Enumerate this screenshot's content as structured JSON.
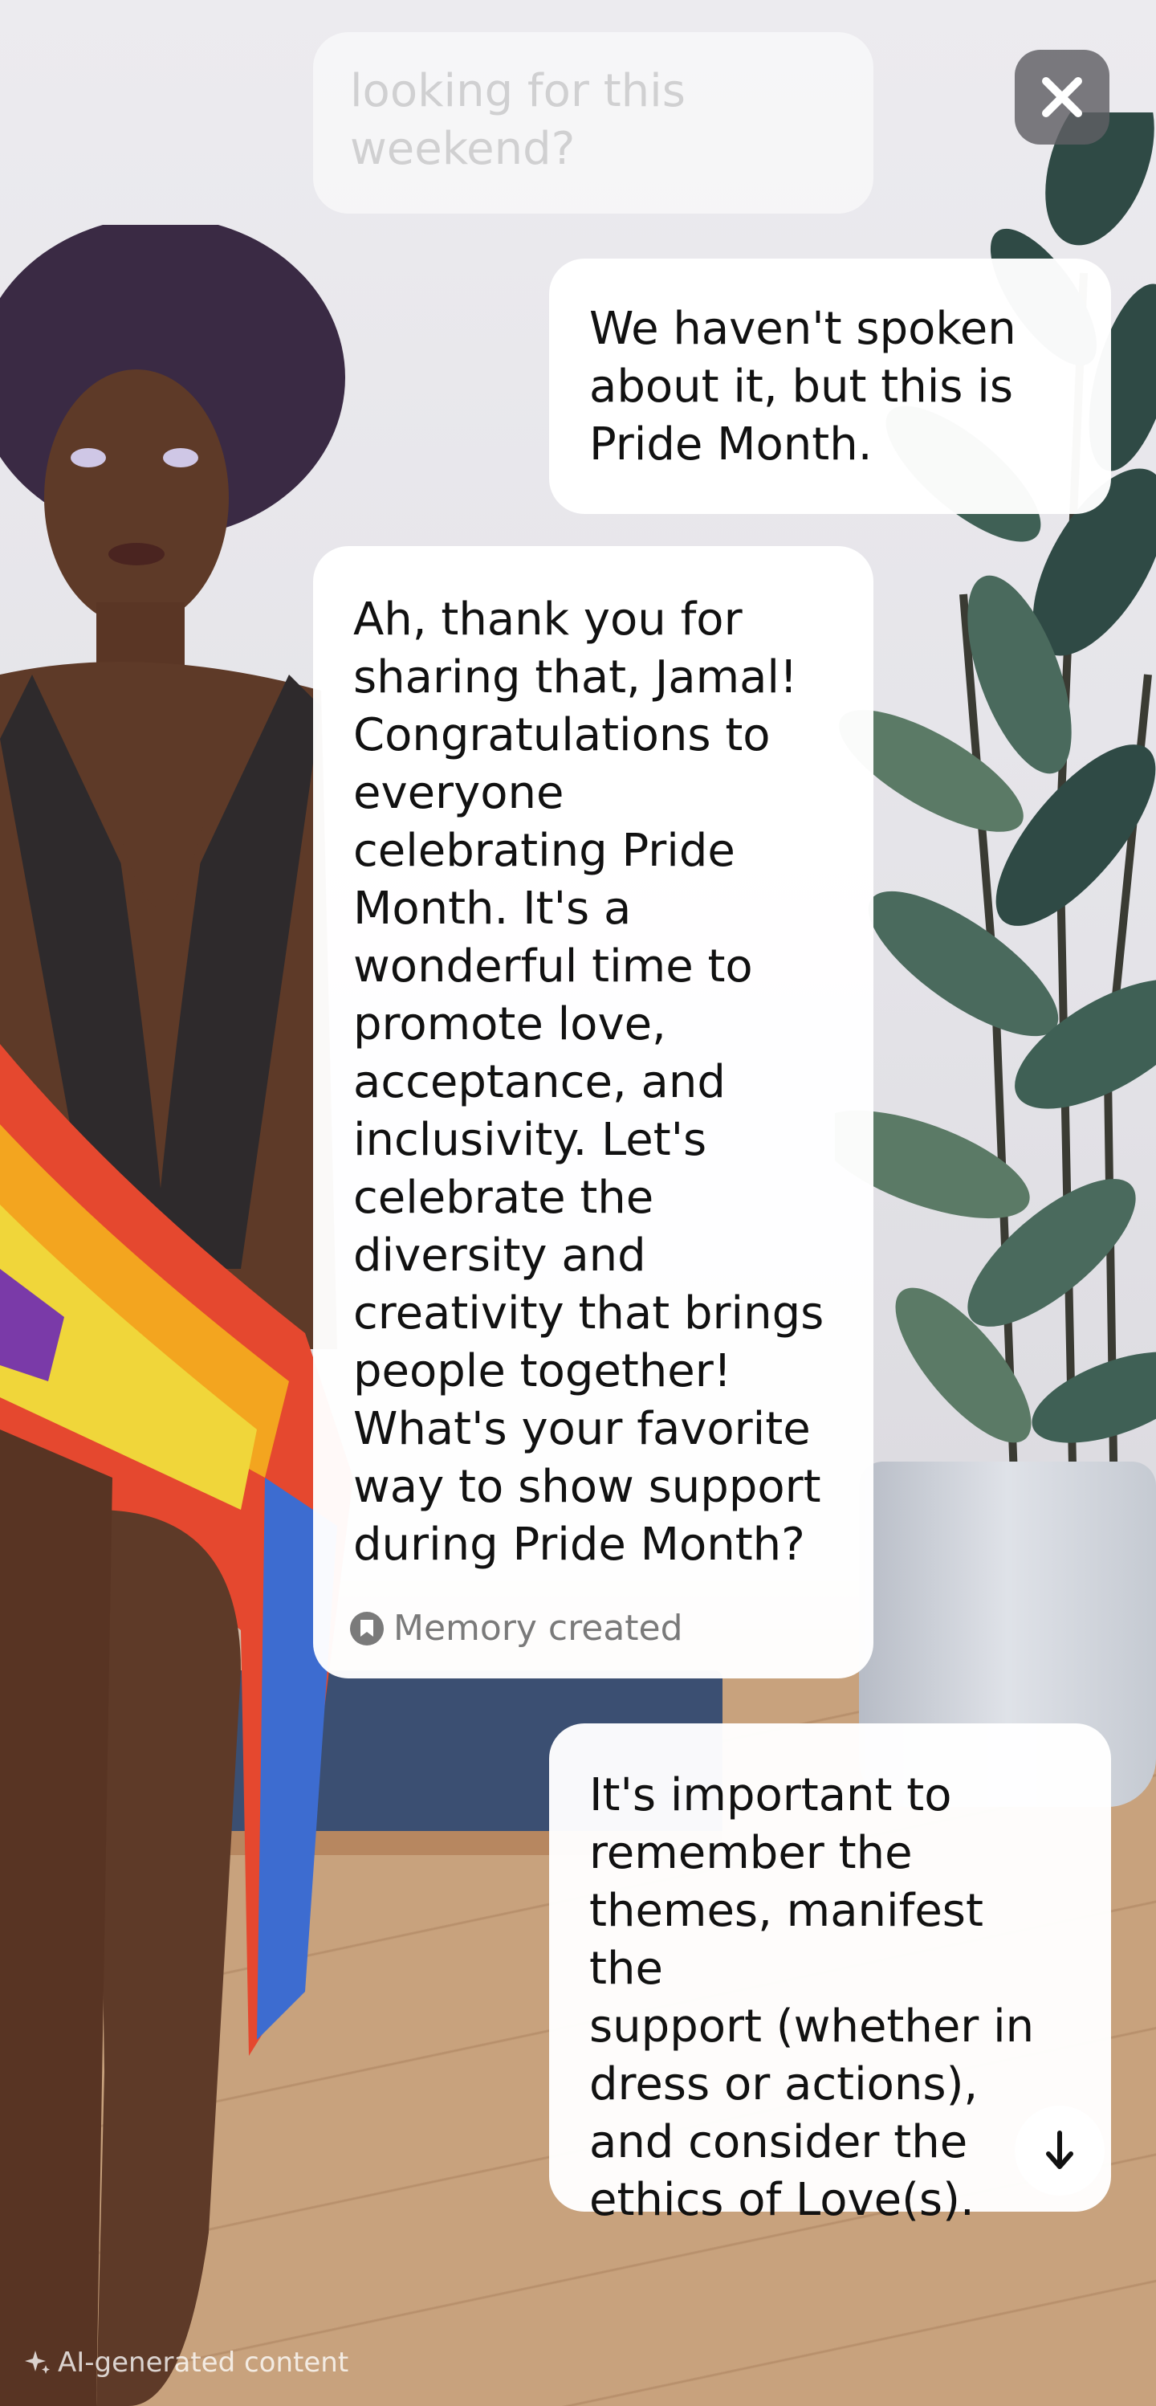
{
  "close_button": {
    "icon": "close-icon"
  },
  "chat": {
    "faded_message": {
      "line1": "looking for this",
      "line2": "weekend?"
    },
    "user_message_1": {
      "lines": [
        "We haven't spoken",
        "about it, but this is",
        "Pride Month."
      ]
    },
    "ai_message": {
      "lines": [
        "Ah, thank you for",
        "sharing that, Jamal!",
        "Congratulations to",
        "everyone",
        "celebrating Pride",
        "Month. It's a",
        "wonderful time to",
        "promote love,",
        "acceptance, and",
        "inclusivity. Let's",
        "celebrate the",
        "diversity and",
        "creativity that brings",
        "people together!",
        "What's your favorite",
        "way to show support",
        "during Pride Month?"
      ],
      "memory_label": "Memory created",
      "memory_icon": "bookmark-icon"
    },
    "user_message_2": {
      "lines": [
        "It's important to",
        "remember the",
        "themes, manifest the",
        "support (whether in",
        "dress or actions),",
        "and consider the",
        "ethics of Love(s)."
      ]
    }
  },
  "scroll_down_button": {
    "icon": "arrow-down-icon"
  },
  "footer": {
    "ai_label": "AI-generated content",
    "icon": "sparkle-icon"
  },
  "colors": {
    "bubble_bg": "#ffffff",
    "text": "#111111",
    "muted": "#7a7a7a",
    "close_bg": "#5f5f64"
  }
}
